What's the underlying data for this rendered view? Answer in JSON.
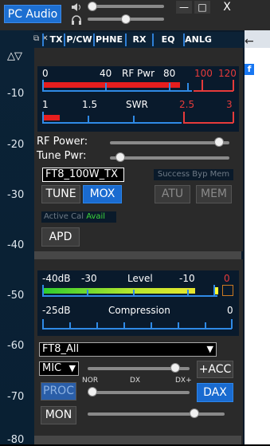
{
  "topbar": {
    "pc_audio_label": "PC Audio",
    "minimize_symbol": "—",
    "maximize_symbol": "□",
    "close_symbol": "X",
    "speaker_icon": "speaker-icon",
    "headphones_icon": "headphones-icon"
  },
  "left_ruler": {
    "arrows": "△▽",
    "labels": [
      "-10",
      "-20",
      "-30",
      "-40",
      "-50",
      "-60",
      "-70",
      "-80"
    ]
  },
  "tabs": {
    "dock_icons": "⧉ ✕",
    "items": [
      "TX",
      "P/CW",
      "PHNE",
      "RX",
      "EQ",
      "ANLG"
    ]
  },
  "tx_meter": {
    "rf_scale": [
      "0",
      "40",
      "RF Pwr",
      "80",
      "100",
      "120"
    ],
    "swr_scale": [
      "1",
      "1.5",
      "SWR",
      "2.5",
      "3"
    ]
  },
  "tx_controls": {
    "rf_power_label": "RF Power:",
    "rf_power_level": 0.95,
    "tune_pwr_label": "Tune Pwr:",
    "tune_pwr_level": 0.05,
    "profile_value": "FT8_100W_TX",
    "status_text": "Success Byp Mem",
    "tune_label": "TUNE",
    "mox_label": "MOX",
    "atu_label": "ATU",
    "mem_label": "MEM",
    "active_cal_label": "Active Cal",
    "avail_label": "Avail",
    "apd_label": "APD"
  },
  "level_meter": {
    "level_scale": [
      "-40dB",
      "-30",
      "Level",
      "-10",
      "0"
    ],
    "compression_scale": [
      "-25dB",
      "Compression",
      "0"
    ]
  },
  "audio_controls": {
    "profile_value": "FT8_All",
    "mic_value": "MIC",
    "mic_level": 0.9,
    "acc_label": "+ACC",
    "proc_label": "PROC",
    "proc_scale": [
      "NOR",
      "DX",
      "DX+"
    ],
    "proc_level": 0.0,
    "dax_label": "DAX",
    "mon_label": "MON",
    "mon_level": 0.8
  },
  "colors": {
    "accent_blue": "#1a6bd0",
    "meter_red": "#e63b3b",
    "avail_green": "#3bd63b"
  }
}
